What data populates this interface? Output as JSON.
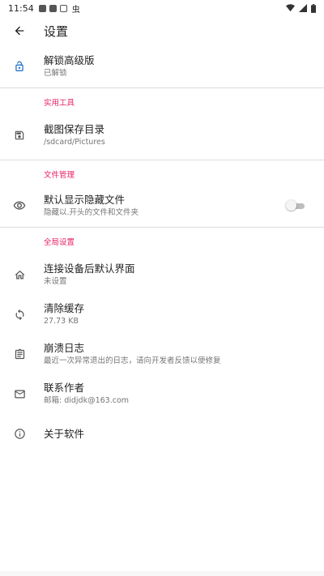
{
  "status_bar": {
    "time": "11:54",
    "bug_glyph": "虫"
  },
  "header": {
    "title": "设置",
    "back_icon": "arrow-back-icon"
  },
  "unlock": {
    "title": "解锁高级版",
    "subtitle": "已解锁",
    "icon": "lock-open-icon",
    "icon_color": "#1565c0"
  },
  "sections": {
    "tools": "实用工具",
    "file_management": "文件管理",
    "global": "全局设置"
  },
  "screenshot_dir": {
    "title": "截图保存目录",
    "subtitle": "/sdcard/Pictures",
    "icon": "save-icon"
  },
  "show_hidden": {
    "title": "默认显示隐藏文件",
    "subtitle": "隐藏以.开头的文件和文件夹",
    "icon": "eye-icon",
    "enabled": false
  },
  "default_screen": {
    "title": "连接设备后默认界面",
    "subtitle": "未设置",
    "icon": "home-icon"
  },
  "clear_cache": {
    "title": "清除缓存",
    "subtitle": "27.73 KB",
    "icon": "sync-icon"
  },
  "crash_log": {
    "title": "崩溃日志",
    "subtitle": "最近一次异常退出的日志，请向开发者反馈以便修复",
    "icon": "clipboard-icon"
  },
  "contact": {
    "title": "联系作者",
    "subtitle": "邮箱: didjdk@163.com",
    "icon": "mail-icon"
  },
  "about": {
    "title": "关于软件",
    "icon": "info-icon"
  },
  "colors": {
    "accent": "#e91e63",
    "text_primary": "#212121",
    "text_secondary": "#757575",
    "divider": "#dcdcdc"
  }
}
